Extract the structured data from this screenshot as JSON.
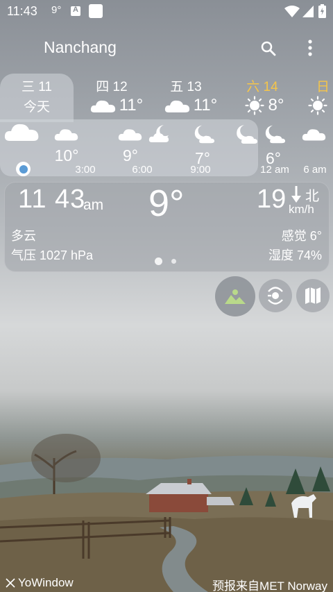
{
  "status_bar": {
    "time": "11:43",
    "temperature": "9°"
  },
  "header": {
    "city": "Nanchang"
  },
  "days": [
    {
      "weekday": "三 11",
      "sub": "今天"
    },
    {
      "weekday": "四 12",
      "temp": "11°",
      "icon": "cloud-icon"
    },
    {
      "weekday": "五 13",
      "temp": "11°",
      "icon": "cloud-icon"
    },
    {
      "weekday": "六 14",
      "temp": "8°",
      "icon": "sun-icon",
      "highlight": "#f5c54a"
    },
    {
      "weekday": "日",
      "icon": "sun-icon",
      "highlight": "#f5c54a"
    }
  ],
  "hourly": [
    {
      "temp": "10°",
      "time": "3:00"
    },
    {
      "temp": "9°",
      "time": "6:00"
    },
    {
      "temp": "7°",
      "time": "9:00"
    },
    {
      "temp": "6°",
      "time": "12 am"
    },
    {
      "time": "6 am"
    }
  ],
  "current": {
    "time": "11 43",
    "ampm": "am",
    "temperature": "9°",
    "wind_speed": "19",
    "wind_unit": "km/h",
    "wind_direction": "北",
    "condition": "多云",
    "feels_like": "感觉 6°",
    "pressure": "气压 1027 hPa",
    "humidity": "湿度 74%"
  },
  "footer": {
    "brand": "YoWindow",
    "source": "预报来自MET Norway"
  },
  "colors": {
    "weekend_accent": "#f5c54a"
  }
}
